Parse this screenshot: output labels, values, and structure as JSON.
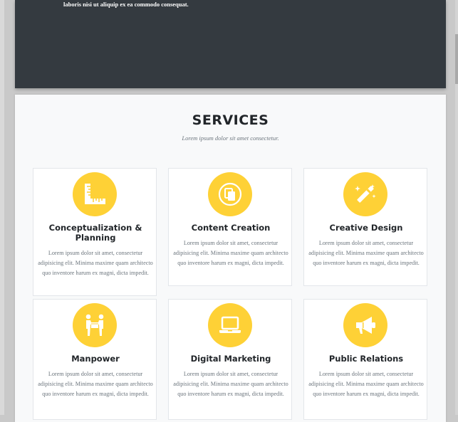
{
  "hero": {
    "text": "laboris nisi ut aliquip ex ea commodo consequat."
  },
  "services": {
    "title": "SERVICES",
    "subtitle": "Lorem ipsum dolor sit amet consectetur.",
    "accent_color": "#fed136",
    "items": [
      {
        "title": "Conceptualization & Planning",
        "icon": "ruler-square-icon",
        "text": "Lorem ipsum dolor sit amet, consectetur adipisicing elit. Minima maxime quam architecto quo inventore harum ex magni, dicta impedit."
      },
      {
        "title": "Content Creation",
        "icon": "copy-icon",
        "text": "Lorem ipsum dolor sit amet, consectetur adipisicing elit. Minima maxime quam architecto quo inventore harum ex magni, dicta impedit."
      },
      {
        "title": "Creative Design",
        "icon": "magic-wand-icon",
        "text": "Lorem ipsum dolor sit amet, consectetur adipisicing elit. Minima maxime quam architecto quo inventore harum ex magni, dicta impedit."
      },
      {
        "title": "Manpower",
        "icon": "people-carry-icon",
        "text": "Lorem ipsum dolor sit amet, consectetur adipisicing elit. Minima maxime quam architecto quo inventore harum ex magni, dicta impedit."
      },
      {
        "title": "Digital Marketing",
        "icon": "laptop-icon",
        "text": "Lorem ipsum dolor sit amet, consectetur adipisicing elit. Minima maxime quam architecto quo inventore harum ex magni, dicta impedit."
      },
      {
        "title": "Public Relations",
        "icon": "megaphone-icon",
        "text": "Lorem ipsum dolor sit amet, consectetur adipisicing elit. Minima maxime quam architecto quo inventore harum ex magni, dicta impedit."
      }
    ]
  }
}
